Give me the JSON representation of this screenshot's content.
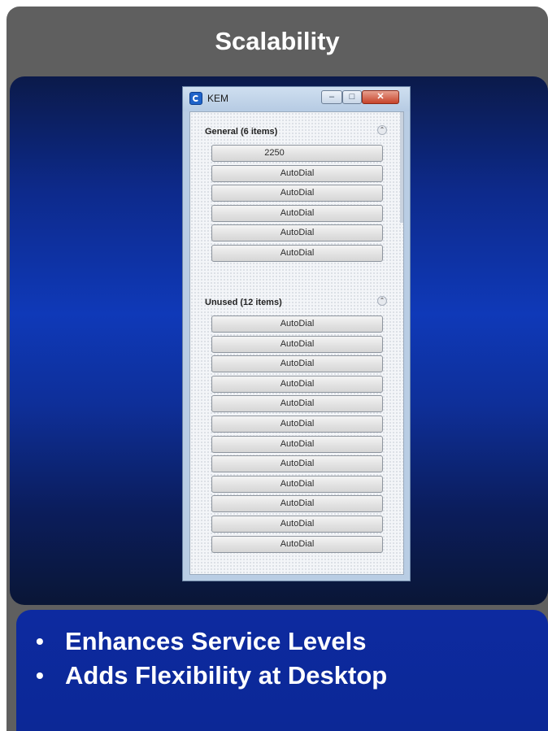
{
  "slide": {
    "title": "Scalability",
    "bullets": [
      "Enhances Service Levels",
      "Adds Flexibility at Desktop"
    ]
  },
  "window": {
    "title": "KEM",
    "controls": {
      "minimize_icon": "minimize-icon",
      "maximize_icon": "maximize-icon",
      "close_icon": "close-icon"
    },
    "groups": [
      {
        "label": "General (6 items)",
        "items": [
          "2250",
          "AutoDial",
          "AutoDial",
          "AutoDial",
          "AutoDial",
          "AutoDial"
        ]
      },
      {
        "label": "Unused (12 items)",
        "items": [
          "AutoDial",
          "AutoDial",
          "AutoDial",
          "AutoDial",
          "AutoDial",
          "AutoDial",
          "AutoDial",
          "AutoDial",
          "AutoDial",
          "AutoDial",
          "AutoDial",
          "AutoDial"
        ]
      }
    ]
  },
  "colors": {
    "frame": "#5f5f5f",
    "panel_dark": "#0b1a4a",
    "panel_blue": "#0f39b8",
    "bullet_panel": "#0d2aa0",
    "close_red": "#c7432a"
  }
}
